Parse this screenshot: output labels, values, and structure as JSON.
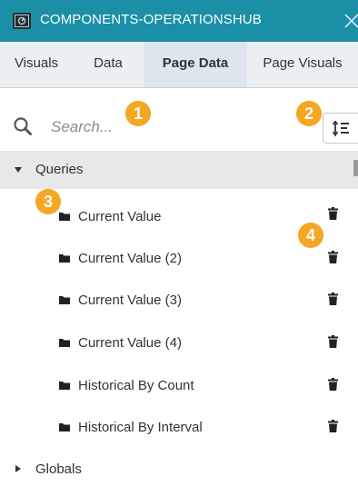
{
  "window": {
    "title": "COMPONENTS-OPERATIONSHUB",
    "icons": {
      "app": "dashboard-app-icon",
      "close": "close-icon"
    }
  },
  "tabs": [
    {
      "label": "Visuals",
      "active": false
    },
    {
      "label": "Data",
      "active": false
    },
    {
      "label": "Page Data",
      "active": true
    },
    {
      "label": "Page Visuals",
      "active": false
    }
  ],
  "search": {
    "placeholder": "Search...",
    "value": ""
  },
  "toolbar": {
    "sort_icon": "sort-order-icon"
  },
  "tree": {
    "groups": [
      {
        "label": "Queries",
        "expanded": true,
        "items": [
          {
            "label": "Current Value"
          },
          {
            "label": "Current Value (2)"
          },
          {
            "label": "Current Value (3)"
          },
          {
            "label": "Current Value (4)"
          },
          {
            "label": "Historical By Count"
          },
          {
            "label": "Historical By Interval"
          }
        ]
      },
      {
        "label": "Globals",
        "expanded": false
      }
    ]
  },
  "callouts": [
    "1",
    "2",
    "3",
    "4"
  ],
  "colors": {
    "titlebar": "#1a8fa6",
    "callout": "#f5a623",
    "tab_bg": "#eceff1",
    "tab_active": "#dde6ee",
    "expanded_row": "#e6e8ea"
  }
}
